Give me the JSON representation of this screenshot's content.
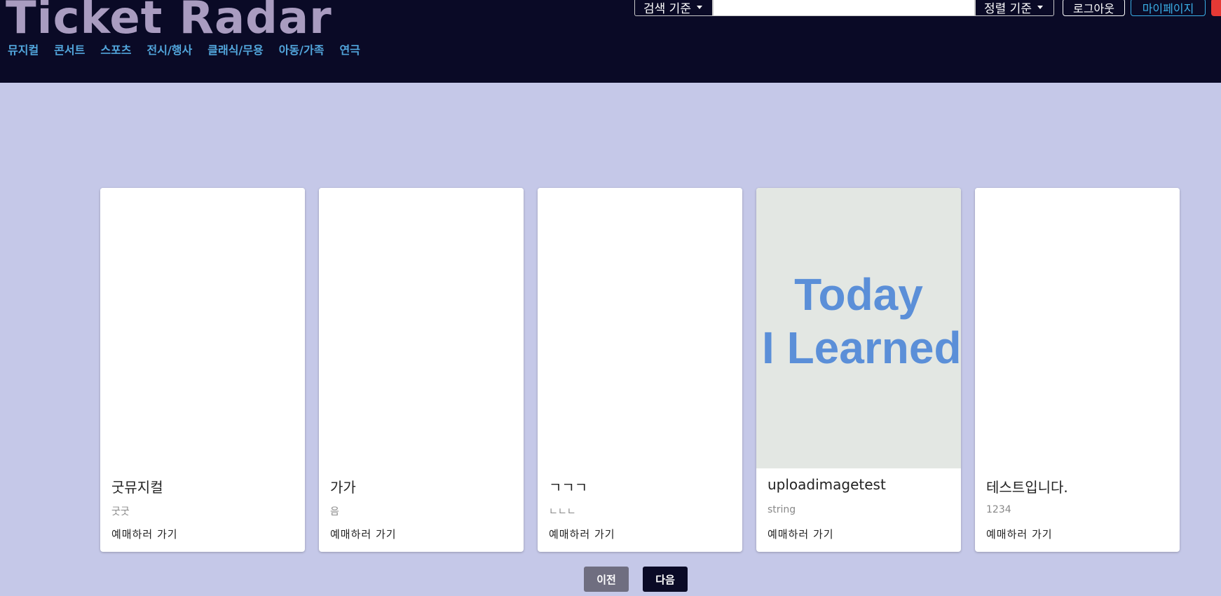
{
  "header": {
    "logo": "Ticket Radar",
    "nav": [
      "뮤지컬",
      "콘서트",
      "스포츠",
      "전시/행사",
      "클래식/무용",
      "아동/가족",
      "연극"
    ],
    "search_criteria_label": "검색 기준",
    "search_input_value": "",
    "sort_criteria_label": "정렬 기준",
    "logout_label": "로그아웃",
    "mypage_label": "마이페이지"
  },
  "cards": [
    {
      "title": "굿뮤지컬",
      "subtitle": "굿굿",
      "link": "예매하러 가기",
      "image": "blank"
    },
    {
      "title": "가가",
      "subtitle": "음",
      "link": "예매하러 가기",
      "image": "blank"
    },
    {
      "title": "ㄱㄱㄱ",
      "subtitle": "ㄴㄴㄴ",
      "link": "예매하러 가기",
      "image": "blank"
    },
    {
      "title": "uploadimagetest",
      "subtitle": "string",
      "link": "예매하러 가기",
      "image": "til",
      "image_text": [
        "Today",
        "I Learned"
      ]
    },
    {
      "title": "테스트입니다.",
      "subtitle": "1234",
      "link": "예매하러 가기",
      "image": "blank"
    }
  ],
  "pagination": {
    "prev_label": "이전",
    "next_label": "다음"
  },
  "colors": {
    "header_bg": "#0a0a26",
    "page_bg": "#c5c8e8",
    "nav_link": "#52a6dc",
    "logo": "#a99cc0",
    "til_text": "#5b8fd8"
  }
}
